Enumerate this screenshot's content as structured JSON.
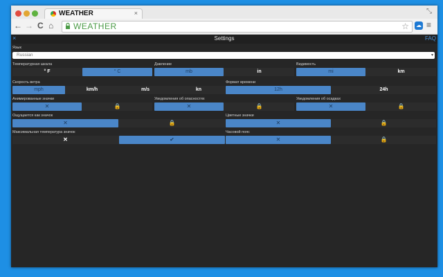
{
  "browser": {
    "tab_title": "WEATHER",
    "tab_close": "×",
    "window_control": "⤡",
    "url": "WEATHER",
    "back": "←",
    "forward": "→",
    "reload": "C",
    "home": "⌂",
    "star": "☆",
    "menu": "≡"
  },
  "settings": {
    "title": "Settings",
    "close": "×",
    "faq": "FAQ",
    "language": {
      "label": "Язык",
      "value": "Russian",
      "caret": "▾"
    },
    "temperature": {
      "label": "Температурная шкала",
      "options": [
        "° F",
        "° C"
      ],
      "selected": 1
    },
    "pressure": {
      "label": "Давление",
      "options": [
        "mb",
        "in"
      ],
      "selected": 0
    },
    "visibility": {
      "label": "Видимость",
      "options": [
        "mi",
        "km"
      ],
      "selected": 0
    },
    "wind": {
      "label": "Скорость ветра",
      "options": [
        "mph",
        "km/h",
        "m/s",
        "kn"
      ],
      "selected": 0
    },
    "time_format": {
      "label": "Формат времени",
      "options": [
        "12h",
        "24h"
      ],
      "selected": 0
    },
    "animated_icons": {
      "label": "Анимированные значки",
      "options": [
        "✕",
        "🔒"
      ],
      "selected": 0
    },
    "hazard_notifications": {
      "label": "Уведомления об опасностях",
      "options": [
        "✕",
        "🔒"
      ],
      "selected": 0
    },
    "precip_notifications": {
      "label": "Уведомления об осадках",
      "options": [
        "✕",
        "🔒"
      ],
      "selected": 0
    },
    "feels_like_icon": {
      "label": "Ощущается как значок",
      "options": [
        "✕",
        "🔒"
      ],
      "selected": 0
    },
    "color_icons": {
      "label": "Цветные значки",
      "options": [
        "✕",
        "🔒"
      ],
      "selected": 0
    },
    "max_temp_icon": {
      "label": "Максимальная температура значок",
      "options": [
        "✕",
        "✔"
      ],
      "selected": 1
    },
    "time_zone": {
      "label": "Часовой пояс",
      "options": [
        "✕",
        "🔒"
      ],
      "selected": 0
    }
  }
}
